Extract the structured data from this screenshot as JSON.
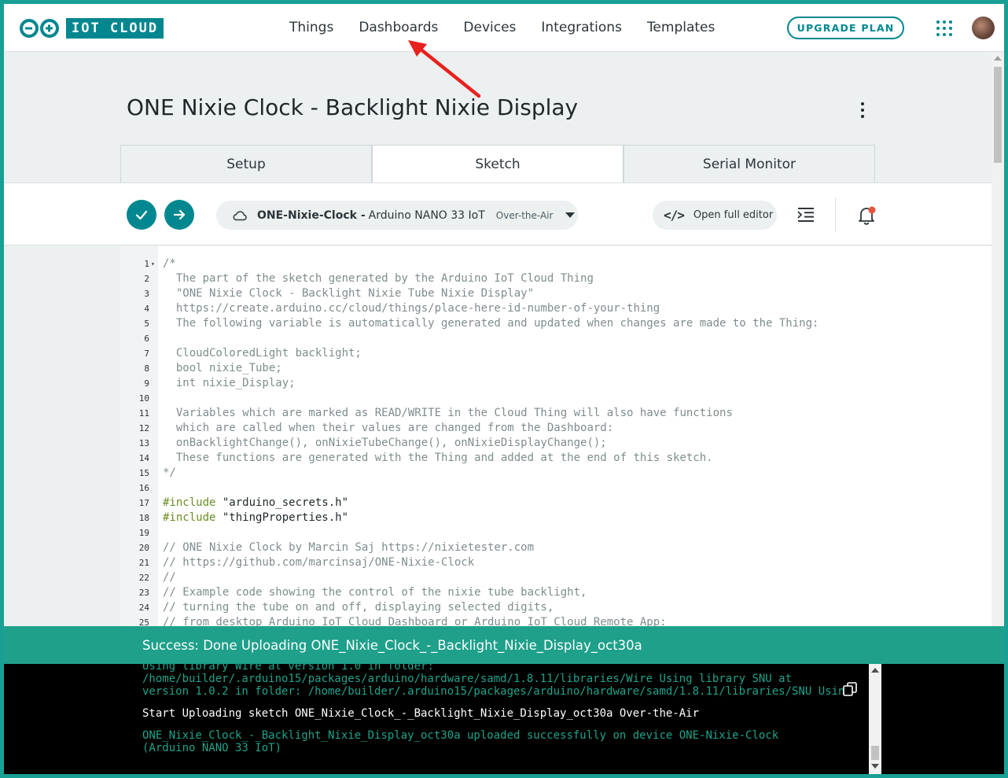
{
  "brand": {
    "logo_text": "IOT CLOUD",
    "accent": "#00878f",
    "success": "#1ea08a"
  },
  "nav": {
    "items": [
      "Things",
      "Dashboards",
      "Devices",
      "Integrations",
      "Templates"
    ]
  },
  "header": {
    "upgrade_label": "UPGRADE PLAN"
  },
  "page": {
    "title": "ONE Nixie Clock - Backlight Nixie Display"
  },
  "tabs": [
    {
      "label": "Setup",
      "active": false
    },
    {
      "label": "Sketch",
      "active": true
    },
    {
      "label": "Serial Monitor",
      "active": false
    }
  ],
  "toolbar": {
    "device_name": "ONE-Nixie-Clock -",
    "device_board": "Arduino NANO 33 IoT",
    "device_mode": "Over-the-Air",
    "open_editor_label": "Open full editor",
    "open_editor_icon": "</>"
  },
  "code": {
    "lines": [
      {
        "n": "1",
        "fold": true,
        "cls": "c-comment",
        "text": "/*"
      },
      {
        "n": "2",
        "cls": "c-comment",
        "text": "  The part of the sketch generated by the Arduino IoT Cloud Thing"
      },
      {
        "n": "3",
        "cls": "c-comment",
        "text": "  \"ONE Nixie Clock - Backlight Nixie Tube Nixie Display\""
      },
      {
        "n": "4",
        "cls": "c-comment",
        "text": "  https://create.arduino.cc/cloud/things/place-here-id-number-of-your-thing"
      },
      {
        "n": "5",
        "cls": "c-comment",
        "text": "  The following variable is automatically generated and updated when changes are made to the Thing:"
      },
      {
        "n": "6",
        "cls": "c-comment",
        "text": ""
      },
      {
        "n": "7",
        "cls": "c-comment",
        "text": "  CloudColoredLight backlight;"
      },
      {
        "n": "8",
        "cls": "c-comment",
        "text": "  bool nixie_Tube;"
      },
      {
        "n": "9",
        "cls": "c-comment",
        "text": "  int nixie_Display;"
      },
      {
        "n": "10",
        "cls": "c-comment",
        "text": ""
      },
      {
        "n": "11",
        "cls": "c-comment",
        "text": "  Variables which are marked as READ/WRITE in the Cloud Thing will also have functions"
      },
      {
        "n": "12",
        "cls": "c-comment",
        "text": "  which are called when their values are changed from the Dashboard:"
      },
      {
        "n": "13",
        "cls": "c-comment",
        "text": "  onBacklightChange(), onNixieTubeChange(), onNixieDisplayChange();"
      },
      {
        "n": "14",
        "cls": "c-comment",
        "text": "  These functions are generated with the Thing and added at the end of this sketch."
      },
      {
        "n": "15",
        "cls": "c-comment",
        "text": "*/"
      },
      {
        "n": "16",
        "cls": "c-comment",
        "text": ""
      },
      {
        "n": "17",
        "cls": "c-dir",
        "text": "#include",
        "extra": " \"arduino_secrets.h\""
      },
      {
        "n": "18",
        "cls": "c-dir",
        "text": "#include",
        "extra": " \"thingProperties.h\""
      },
      {
        "n": "19",
        "cls": "c-comment",
        "text": ""
      },
      {
        "n": "20",
        "cls": "c-comment",
        "text": "// ONE Nixie Clock by Marcin Saj https://nixietester.com"
      },
      {
        "n": "21",
        "cls": "c-comment",
        "text": "// https://github.com/marcinsaj/ONE-Nixie-Clock"
      },
      {
        "n": "22",
        "cls": "c-comment",
        "text": "//"
      },
      {
        "n": "23",
        "cls": "c-comment",
        "text": "// Example code showing the control of the nixie tube backlight,"
      },
      {
        "n": "24",
        "cls": "c-comment",
        "text": "// turning the tube on and off, displaying selected digits,"
      },
      {
        "n": "25",
        "cls": "c-comment",
        "text": "// from desktop Arduino IoT Cloud Dashboard or Arduino IoT Cloud Remote App:"
      }
    ]
  },
  "status": {
    "message": "Success: Done Uploading ONE_Nixie_Clock_-_Backlight_Nixie_Display_oct30a"
  },
  "console": {
    "lines": [
      {
        "cls": "con-green",
        "text": "Using library Wire at version 1.0 in folder:"
      },
      {
        "cls": "con-green",
        "text": "/home/builder/.arduino15/packages/arduino/hardware/samd/1.8.11/libraries/Wire Using library SNU at"
      },
      {
        "cls": "con-green",
        "text": "version 1.0.2 in folder: /home/builder/.arduino15/packages/arduino/hardware/samd/1.8.11/libraries/SNU Usin"
      },
      {
        "cls": "con-white",
        "text": "Start Uploading sketch ONE_Nixie_Clock_-_Backlight_Nixie_Display_oct30a Over-the-Air"
      },
      {
        "cls": "con-green",
        "text": "ONE_Nixie_Clock_-_Backlight_Nixie_Display_oct30a uploaded successfully on device ONE-Nixie-Clock"
      },
      {
        "cls": "con-green",
        "text": "(Arduino NANO 33 IoT)"
      }
    ]
  }
}
